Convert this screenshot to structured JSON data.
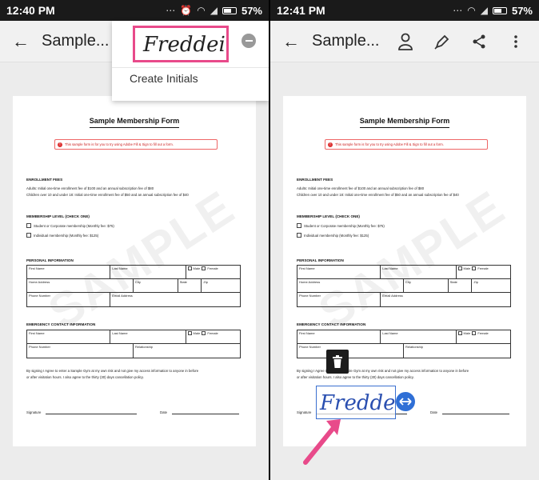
{
  "left": {
    "statusbar": {
      "time": "12:40 PM",
      "battery": "57%"
    },
    "appbar": {
      "title": "Sample..."
    },
    "popup": {
      "signature": "Freddei",
      "create_label": "Create Initials"
    }
  },
  "right": {
    "statusbar": {
      "time": "12:41 PM",
      "battery": "57%"
    },
    "appbar": {
      "title": "Sample..."
    },
    "placed_signature": "Freddei"
  },
  "document": {
    "title": "Sample Membership Form",
    "notice": "This sample form is for you to try using Adobe Fill & Sign to fill out a form.",
    "enrollment": {
      "heading": "ENROLLMENT FEES",
      "line1": "Adults: Initial one-time enrollment fee of $100 and an annual subscription fee of $80",
      "line2": "Children over 10 and under 18: Initial one-time enrollment fee of $50 and an annual subscription fee of $40"
    },
    "membership": {
      "heading": "MEMBERSHIP LEVEL (CHECK ONE)",
      "option1": "Student or Corporate membership (Monthly fee: $75)",
      "option2": "Individual membership (Monthly fee: $125)"
    },
    "personal": {
      "heading": "PERSONAL INFORMATION",
      "first_name": "First Name",
      "last_name": "Last Name",
      "male": "Male",
      "female": "Female",
      "home_address": "Home Address",
      "city": "City",
      "state": "State",
      "zip": "Zip",
      "phone": "Phone Number",
      "email": "Email Address"
    },
    "emergency": {
      "heading": "EMERGENCY CONTACT INFORMATION",
      "first_name": "First Name",
      "last_name": "Last Name",
      "male": "Male",
      "female": "Female",
      "phone": "Phone Number",
      "relationship": "Relationship"
    },
    "agreement": {
      "line1": "By signing I Agree to enter a Sample Gym at my own risk and not give my access information to anyone in before",
      "line2": "or after visitation hours. I also agree to the thirty (30) days cancellation policy."
    },
    "signature_label": "Signature",
    "date_label": "Date",
    "watermark": "SAMPLE"
  },
  "colors": {
    "highlight": "#e84a8a",
    "accent": "#2f6fd6",
    "ink": "#2a4fb0"
  }
}
